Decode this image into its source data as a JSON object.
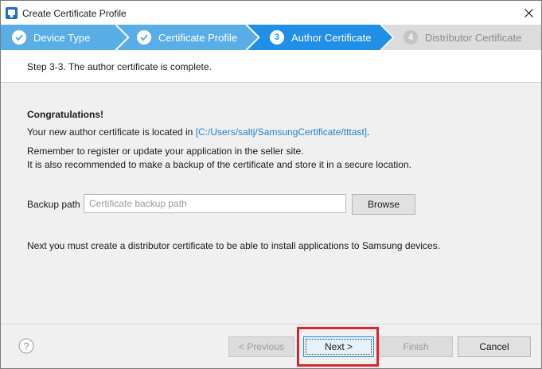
{
  "window": {
    "title": "Create Certificate Profile",
    "icon": "app-certificate-icon",
    "close_icon": "close-icon"
  },
  "steps": [
    {
      "number": "1",
      "label": "Device Type",
      "state": "done"
    },
    {
      "number": "2",
      "label": "Certificate Profile",
      "state": "done"
    },
    {
      "number": "3",
      "label": "Author Certificate",
      "state": "active"
    },
    {
      "number": "4",
      "label": "Distributor Certificate",
      "state": "pending"
    }
  ],
  "header": {
    "message": "Step 3-3. The author certificate is complete."
  },
  "main": {
    "congrats": "Congratulations!",
    "location_prefix": "Your new author certificate is located in ",
    "location_path": "[C:/Users/saltj/SamsungCertificate/tttast]",
    "location_suffix": ".",
    "remember": "Remember to register or update your application in the seller site.",
    "recommend": "It is also recommended to make a backup of the certificate and store it in a secure location.",
    "backup_label": "Backup path",
    "backup_value": "",
    "backup_placeholder": "Certificate backup path",
    "browse_label": "Browse",
    "next_message": "Next you must create a distributor certificate to be able to install applications to Samsung devices."
  },
  "footer": {
    "help_icon": "help-icon",
    "back_label": "< Previous",
    "next_label": "Next >",
    "finish_label": "Finish",
    "cancel_label": "Cancel"
  },
  "colors": {
    "step_done": "#5aaee8",
    "step_active": "#1f8fe8",
    "step_pending": "#dcdcdc",
    "link": "#1f7fd0",
    "highlight": "#e0222a"
  }
}
